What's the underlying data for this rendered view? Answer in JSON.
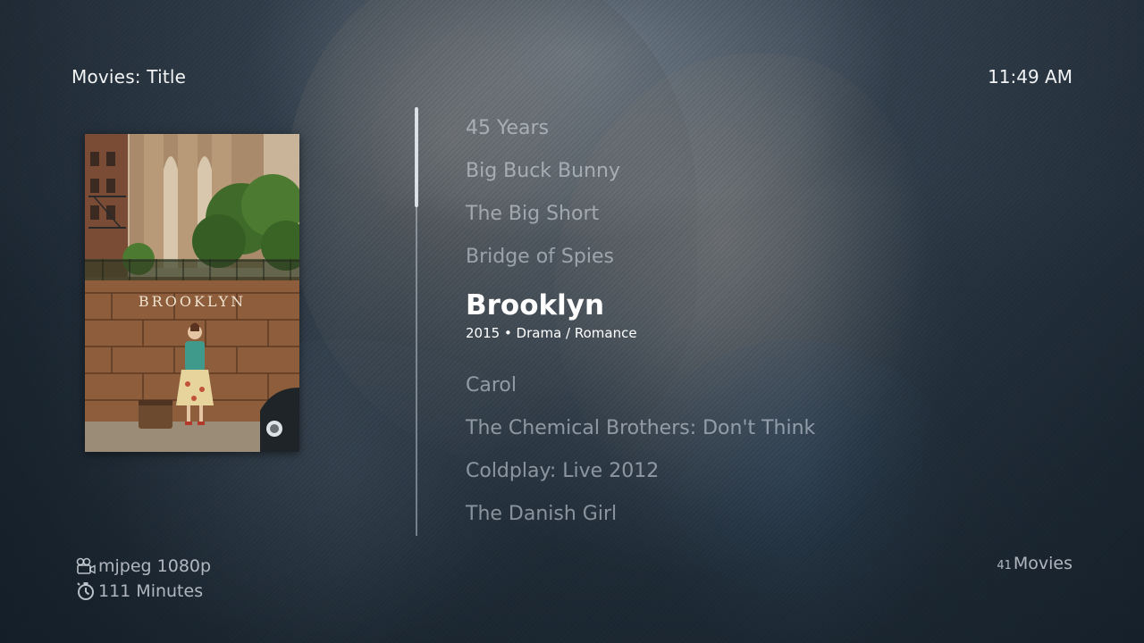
{
  "header": {
    "title": "Movies: Title",
    "clock": "11:49 AM"
  },
  "poster": {
    "title_text": "BROOKLYN"
  },
  "list": {
    "items": [
      {
        "label": "45 Years"
      },
      {
        "label": "Big Buck Bunny"
      },
      {
        "label": "The Big Short"
      },
      {
        "label": "Bridge of Spies"
      },
      {
        "label": "Brooklyn",
        "subtitle": "2015 • Drama / Romance",
        "selected": true
      },
      {
        "label": "Carol"
      },
      {
        "label": "The Chemical Brothers: Don't Think"
      },
      {
        "label": "Coldplay: Live 2012"
      },
      {
        "label": "The Danish Girl"
      }
    ]
  },
  "footer": {
    "video_info": "mjpeg 1080p",
    "runtime": "111 Minutes",
    "count": "41",
    "count_label": "Movies",
    "video_icon": "video-camera-icon",
    "runtime_icon": "stopwatch-icon"
  },
  "colors": {
    "text_primary": "#ffffff",
    "text_dim": "#dce4ec"
  }
}
